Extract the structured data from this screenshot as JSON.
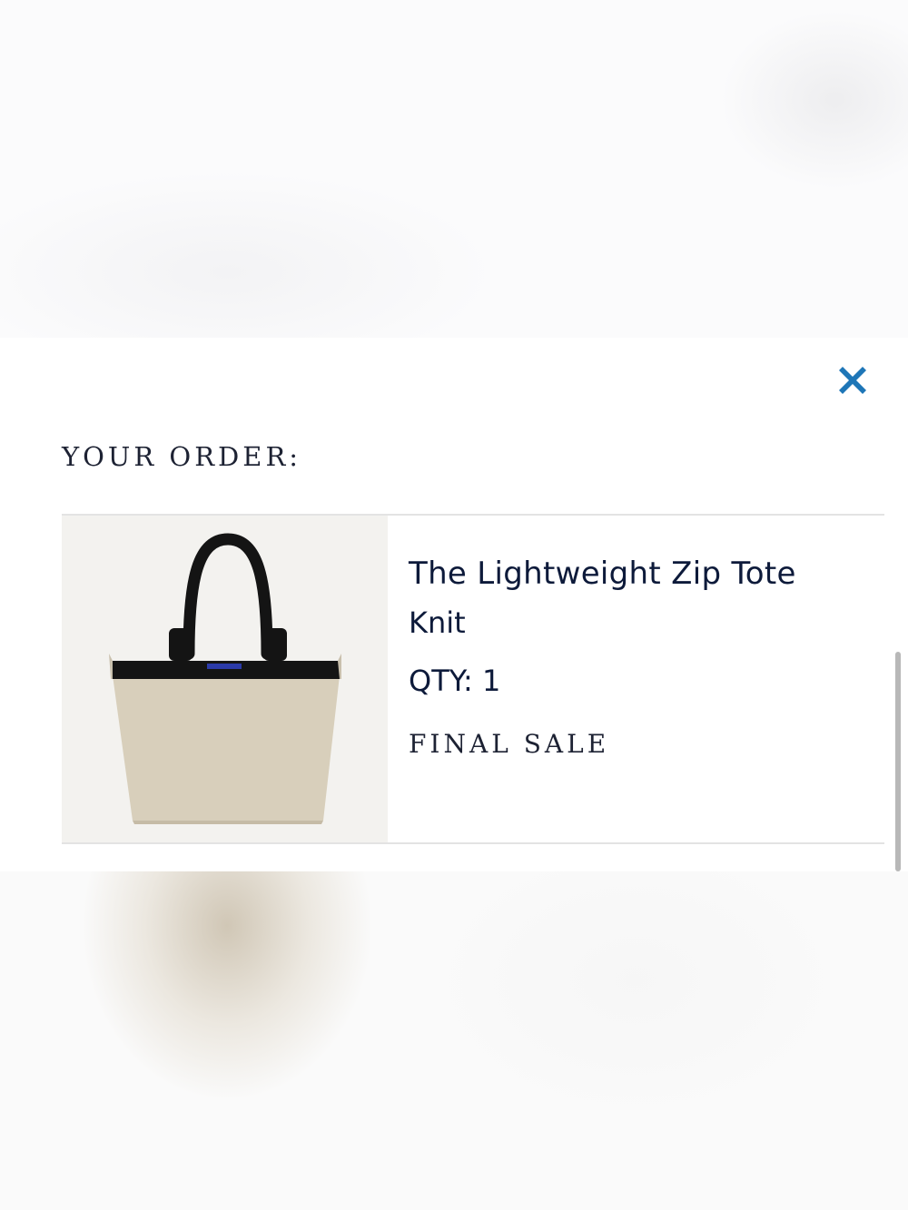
{
  "cart": {
    "heading": "YOUR ORDER:",
    "accent_color": "#1e76b7",
    "close_icon": "close-icon",
    "items": [
      {
        "name": "The Lightweight Zip Tote",
        "variant": "Knit",
        "quantity": "QTY: 1",
        "badge": "FINAL SALE"
      }
    ]
  }
}
